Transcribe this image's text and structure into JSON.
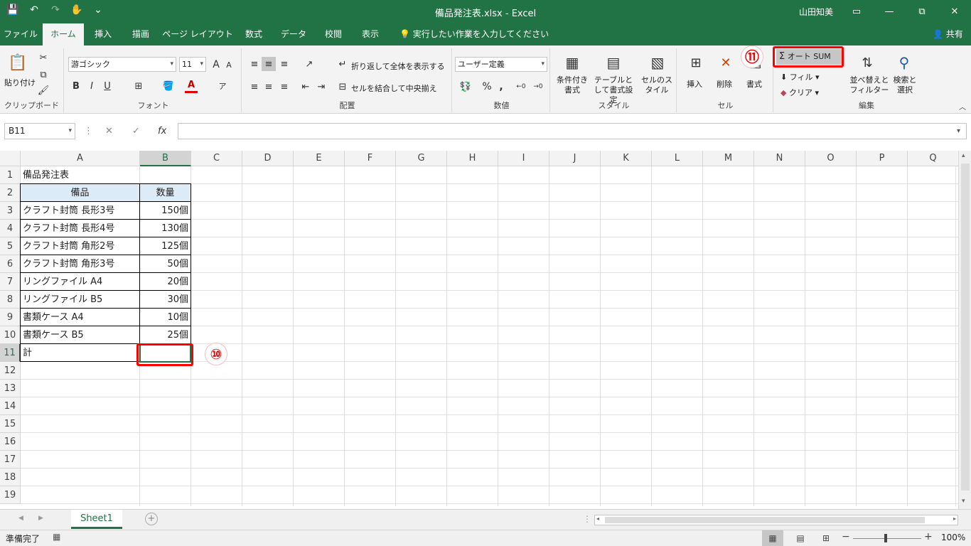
{
  "window": {
    "title": "備品発注表.xlsx - Excel",
    "user": "山田知美",
    "min": "—",
    "restore": "⧉",
    "close": "✕",
    "qat": [
      "💾",
      "↶",
      "↷",
      "✋",
      "⌄"
    ]
  },
  "tabs": [
    "ファイル",
    "ホーム",
    "挿入",
    "描画",
    "ページ レイアウト",
    "数式",
    "データ",
    "校閲",
    "表示"
  ],
  "tellme": "実行したい作業を入力してください",
  "share": "共有",
  "ribbon": {
    "clipboard": {
      "label": "クリップボード",
      "paste": "貼り付け"
    },
    "font": {
      "label": "フォント",
      "name": "游ゴシック",
      "size": "11",
      "bold": "B",
      "italic": "I",
      "underline": "U",
      "grow": "A",
      "shrink": "A",
      "color": "A"
    },
    "alignment": {
      "label": "配置",
      "wrap": "折り返して全体を表示する",
      "merge": "セルを結合して中央揃え"
    },
    "number": {
      "label": "数値",
      "format": "ユーザー定義",
      "percent": "%",
      "comma": ","
    },
    "styles": {
      "label": "スタイル",
      "conditional": "条件付き書式",
      "table": "テーブルとして書式設定",
      "cell": "セルのスタイル"
    },
    "cells": {
      "label": "セル",
      "insert": "挿入",
      "delete": "削除",
      "format": "書式"
    },
    "editing": {
      "label": "編集",
      "autosum": "オート SUM",
      "fill": "フィル",
      "clear": "クリア",
      "sort": "並べ替えとフィルター",
      "find": "検索と選択"
    }
  },
  "formula_bar": {
    "name_box": "B11",
    "value": ""
  },
  "columns": [
    "A",
    "B",
    "C",
    "D",
    "E",
    "F",
    "G",
    "H",
    "I",
    "J",
    "K",
    "L",
    "M",
    "N",
    "O",
    "P",
    "Q"
  ],
  "rows": [
    "1",
    "2",
    "3",
    "4",
    "5",
    "6",
    "7",
    "8",
    "9",
    "10",
    "11",
    "12",
    "13",
    "14",
    "15",
    "16",
    "17",
    "18",
    "19"
  ],
  "cells": {
    "title": "備品発注表",
    "header_item": "備品",
    "header_qty": "数量",
    "items": [
      {
        "name": "クラフト封筒 長形3号",
        "qty": "150個"
      },
      {
        "name": "クラフト封筒 長形4号",
        "qty": "130個"
      },
      {
        "name": "クラフト封筒 角形2号",
        "qty": "125個"
      },
      {
        "name": "クラフト封筒 角形3号",
        "qty": "50個"
      },
      {
        "name": "リングファイル A4",
        "qty": "20個"
      },
      {
        "name": "リングファイル B5",
        "qty": "30個"
      },
      {
        "name": "書類ケース A4",
        "qty": "10個"
      },
      {
        "name": "書類ケース B5",
        "qty": "25個"
      }
    ],
    "total_label": "計"
  },
  "annotations": {
    "step10": "⑩",
    "step11": "⑪"
  },
  "sheet": {
    "name": "Sheet1",
    "add": "+"
  },
  "status": {
    "ready": "準備完了",
    "zoom": "100%",
    "minus": "−",
    "plus": "+"
  }
}
